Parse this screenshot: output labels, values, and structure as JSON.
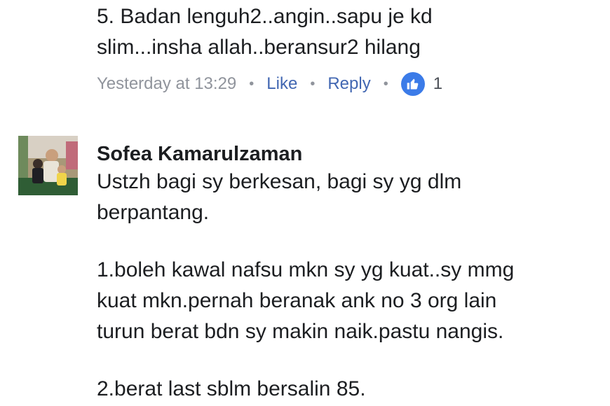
{
  "comment_1": {
    "partial_top_line": "~ ~",
    "lines": [
      "5. Badan lenguh2..angin..sapu je kd",
      "slim...insha allah..beransur2 hilang"
    ],
    "timestamp": "Yesterday at 13:29",
    "separator": "•",
    "like_label": "Like",
    "reply_label": "Reply",
    "reaction_count": "1",
    "reaction_icon": "thumbs-up-icon"
  },
  "comment_2": {
    "author": "Sofea Kamarulzaman",
    "lines": [
      "Ustzh bagi sy berkesan, bagi sy yg dlm",
      "berpantang.",
      "",
      "1.boleh kawal nafsu mkn sy yg kuat..sy mmg",
      "kuat mkn.pernah beranak ank no 3 org lain",
      "turun berat bdn sy makin naik.pastu nangis.",
      "",
      "2.berat last sblm bersalin 85."
    ]
  },
  "colors": {
    "link": "#4267b2",
    "meta_gray": "#90949c",
    "like_blue": "#3b7be8",
    "text": "#1c1e21"
  }
}
